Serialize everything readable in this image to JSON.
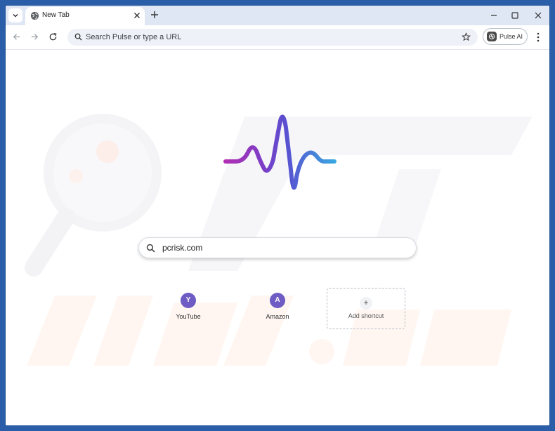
{
  "browser": {
    "tab": {
      "title": "New Tab"
    },
    "omnibox": {
      "placeholder": "Search Pulse or type a URL"
    },
    "extension_button": {
      "label": "Pulse AI"
    }
  },
  "newtab": {
    "search": {
      "value": "pcrisk.com"
    },
    "shortcuts": [
      {
        "initial": "Y",
        "label": "YouTube"
      },
      {
        "initial": "A",
        "label": "Amazon"
      }
    ],
    "add_shortcut": {
      "icon": "+",
      "label": "Add shortcut"
    }
  },
  "colors": {
    "frame": "#2a5ea8",
    "tabstrip": "#dfe7f5",
    "logo_gradient": [
      "#b02fb3",
      "#7b3ec6",
      "#5a4fd0",
      "#3aa7e0"
    ],
    "shortcut_avatar": "#6e5cc4"
  },
  "icons": [
    "tab-menu-icon",
    "globe-icon",
    "close-icon",
    "plus-icon",
    "minimize-icon",
    "maximize-icon",
    "window-close-icon",
    "back-icon",
    "forward-icon",
    "reload-icon",
    "search-icon",
    "star-icon",
    "pulse-ai-icon",
    "kebab-menu-icon",
    "pulse-logo"
  ]
}
